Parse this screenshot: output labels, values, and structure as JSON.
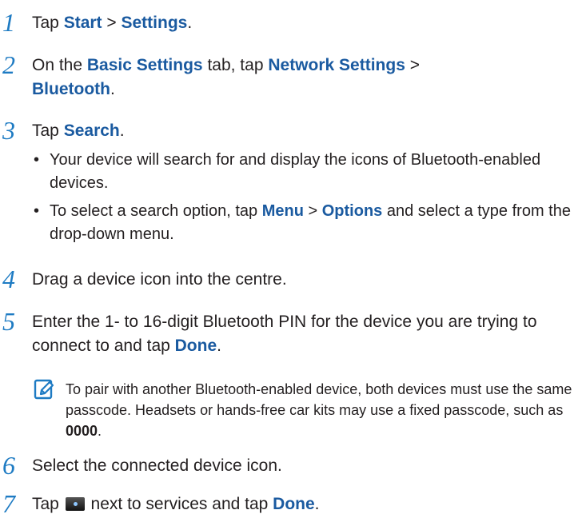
{
  "steps": [
    {
      "num": "1",
      "p1": "Tap ",
      "b1": "Start",
      "p2": " > ",
      "b2": "Settings",
      "p3": "."
    },
    {
      "num": "2",
      "p1": "On the ",
      "b1": "Basic Settings",
      "p2": " tab, tap ",
      "b2": "Network Settings",
      "p3": " >",
      "b3": "Bluetooth",
      "p4": "."
    },
    {
      "num": "3",
      "p1": "Tap ",
      "b1": "Search",
      "p2": "."
    },
    {
      "num": "4",
      "p1": "Drag a device icon into the centre."
    },
    {
      "num": "5",
      "p1": "Enter the 1- to 16-digit Bluetooth PIN for the device you are trying to connect to and tap ",
      "b1": "Done",
      "p2": "."
    },
    {
      "num": "6",
      "p1": "Select the connected device icon."
    },
    {
      "num": "7",
      "p1": "Tap ",
      "p2": " next to services and tap ",
      "b1": "Done",
      "p3": "."
    }
  ],
  "bullets": {
    "bullet_char": "•",
    "b1": "Your device will search for and display the icons of Bluetooth-enabled devices.",
    "b2_p1": "To select a search option, tap ",
    "b2_b1": "Menu",
    "b2_p2": " > ",
    "b2_b2": "Options",
    "b2_p3": " and select a type from the drop-down menu."
  },
  "note": {
    "icon": "note-pencil-icon",
    "p1": "To pair with another Bluetooth-enabled device, both devices must use the same passcode. Headsets or hands-free car kits may use a fixed passcode, such as ",
    "b1": "0000",
    "p2": "."
  },
  "colors": {
    "accent": "#1e7bc3",
    "bold": "#1a5aa0",
    "text": "#231f20"
  }
}
